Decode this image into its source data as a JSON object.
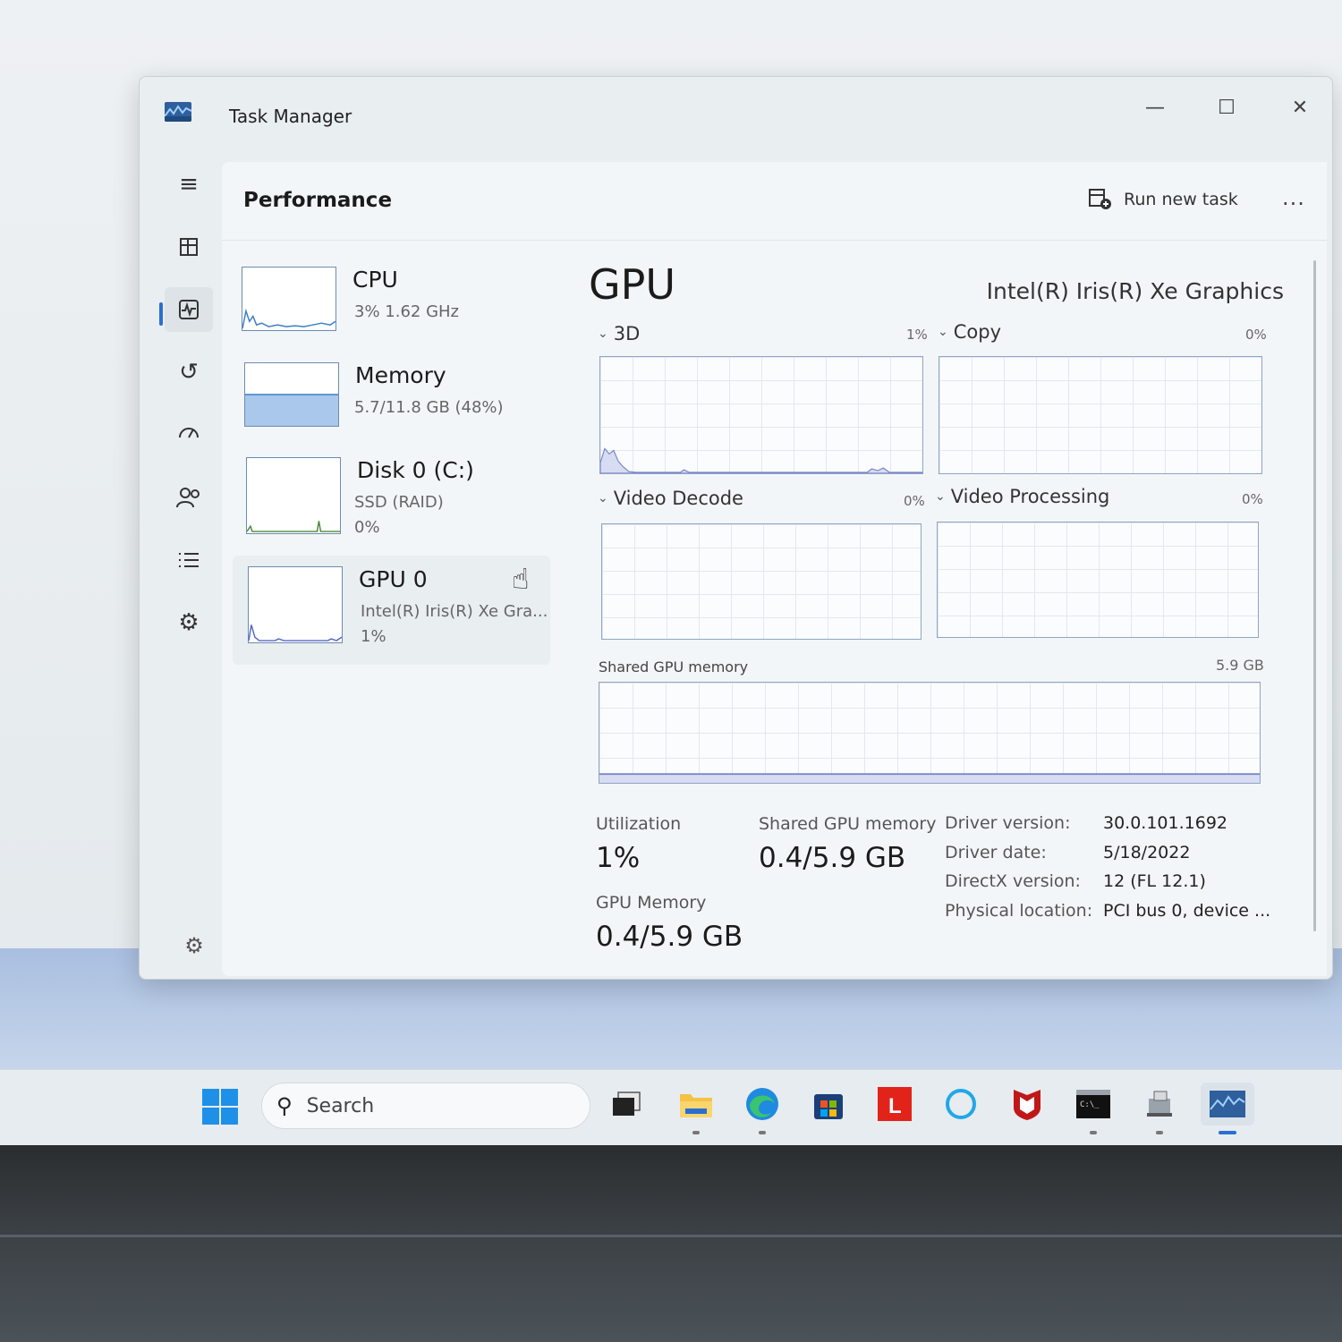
{
  "window": {
    "title": "Task Manager"
  },
  "header": {
    "page_title": "Performance",
    "run_new_task": "Run new task",
    "more": "..."
  },
  "devices": [
    {
      "name": "CPU",
      "line1": "3%  1.62 GHz",
      "line2": ""
    },
    {
      "name": "Memory",
      "line1": "5.7/11.8 GB (48%)",
      "line2": ""
    },
    {
      "name": "Disk 0 (C:)",
      "line1": "SSD (RAID)",
      "line2": "0%"
    },
    {
      "name": "GPU 0",
      "line1": "Intel(R) Iris(R) Xe Gra...",
      "line2": "1%"
    }
  ],
  "gpu": {
    "heading": "GPU",
    "model": "Intel(R) Iris(R) Xe Graphics",
    "graphs": {
      "d3": {
        "label": "3D",
        "pct": "1%"
      },
      "copy": {
        "label": "Copy",
        "pct": "0%"
      },
      "video_decode": {
        "label": "Video Decode",
        "pct": "0%"
      },
      "video_processing": {
        "label": "Video Processing",
        "pct": "0%"
      }
    },
    "shared_memory_graph": {
      "label": "Shared GPU memory",
      "max": "5.9 GB"
    },
    "stats": {
      "utilization_label": "Utilization",
      "utilization_value": "1%",
      "shared_mem_label": "Shared GPU memory",
      "shared_mem_value": "0.4/5.9 GB",
      "gpu_mem_label": "GPU Memory",
      "gpu_mem_value": "0.4/5.9 GB"
    },
    "details": [
      {
        "key": "Driver version:",
        "value": "30.0.101.1692"
      },
      {
        "key": "Driver date:",
        "value": "5/18/2022"
      },
      {
        "key": "DirectX version:",
        "value": "12 (FL 12.1)"
      },
      {
        "key": "Physical location:",
        "value": "PCI bus 0, device ..."
      }
    ]
  },
  "taskbar": {
    "search_placeholder": "Search",
    "apps": [
      "task-view",
      "file-explorer",
      "edge",
      "microsoft-store",
      "lenovo-vantage",
      "cortana",
      "mcafee",
      "terminal",
      "device-manager",
      "task-manager"
    ]
  },
  "colors": {
    "accent": "#2a6fd1",
    "memory_fill": "#a9c8ec",
    "graph_line": "#7a86c9"
  }
}
